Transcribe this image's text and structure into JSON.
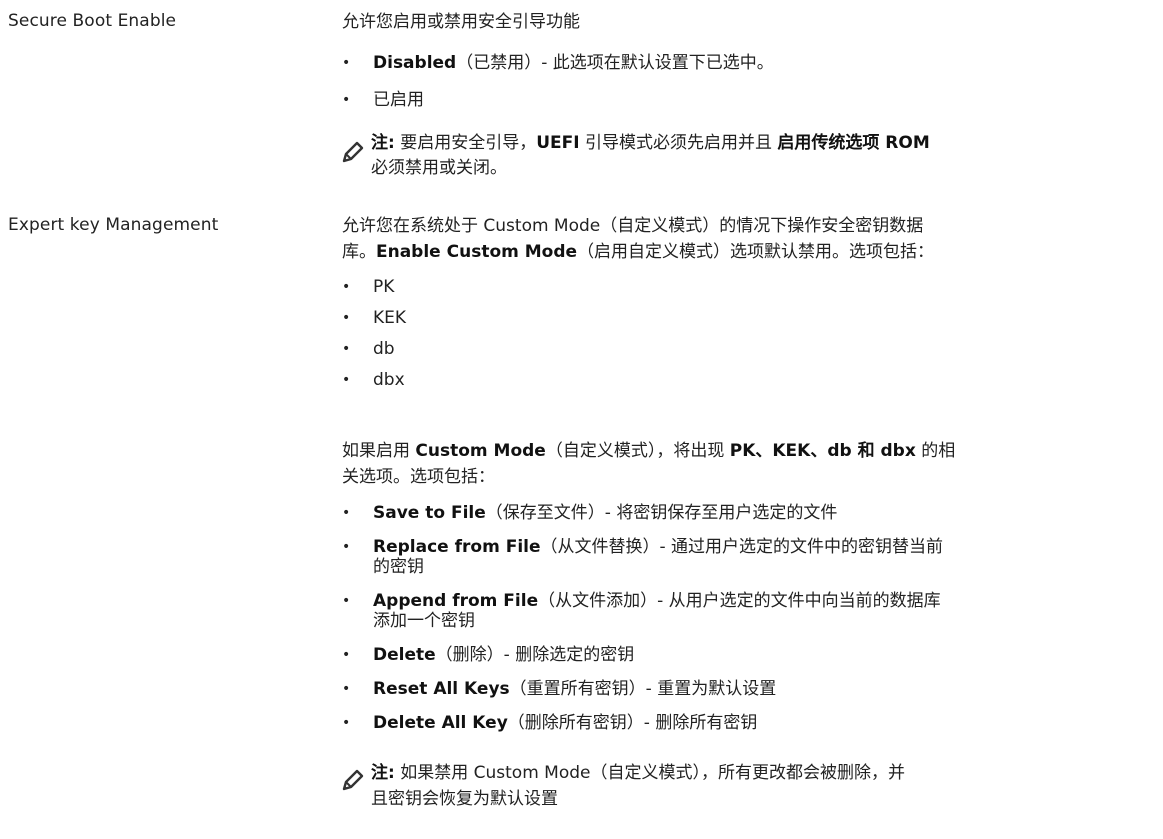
{
  "rows": [
    {
      "label": "Secure Boot Enable",
      "desc": "允许您启用或禁用安全引导功能",
      "bullets": [
        {
          "bold": "Disabled",
          "rest": "（已禁用）- 此选项在默认设置下已选中。"
        },
        {
          "bold": "",
          "rest": "已启用"
        }
      ],
      "note": {
        "prefix": "注:",
        "t1": " 要启用安全引导，",
        "b1": "UEFI",
        "t2": " 引导模式必须先启用并且 ",
        "b2": "启用传统选项 ROM",
        "line2": "必须禁用或关闭。"
      }
    },
    {
      "label": "Expert key Management",
      "desc_line1": "允许您在系统处于 Custom Mode（自定义模式）的情况下操作安全密钥数据",
      "desc_line2_pre": "库。",
      "desc_line2_bold": "Enable Custom Mode",
      "desc_line2_post": "（启用自定义模式）选项默认禁用。选项包括：",
      "keys": [
        "PK",
        "KEK",
        "db",
        "dbx"
      ],
      "para_pre": "如果启用 ",
      "para_bold1": "Custom Mode",
      "para_mid": "（自定义模式），将出现 ",
      "para_bold2": "PK、KEK、db 和 dbx",
      "para_post": " 的相",
      "para_line2": "关选项。选项包括：",
      "options": [
        {
          "bold": "Save to File",
          "rest": "（保存至文件）- 将密钥保存至用户选定的文件",
          "line2": ""
        },
        {
          "bold": "Replace from File",
          "rest": "（从文件替换）- 通过用户选定的文件中的密钥替当前",
          "line2": "的密钥"
        },
        {
          "bold": "Append from File",
          "rest": "（从文件添加）- 从用户选定的文件中向当前的数据库",
          "line2": "添加一个密钥"
        },
        {
          "bold": "Delete",
          "rest": "（删除）- 删除选定的密钥",
          "line2": ""
        },
        {
          "bold": "Reset All Keys",
          "rest": "（重置所有密钥）- 重置为默认设置",
          "line2": ""
        },
        {
          "bold": "Delete All Key",
          "rest": "（删除所有密钥）- 删除所有密钥",
          "line2": ""
        }
      ],
      "note": {
        "prefix": "注:",
        "line1": " 如果禁用 Custom Mode（自定义模式），所有更改都会被删除，并",
        "line2": "且密钥会恢复为默认设置"
      }
    }
  ],
  "bullet_char": "•",
  "icon": "pencil-note-icon"
}
